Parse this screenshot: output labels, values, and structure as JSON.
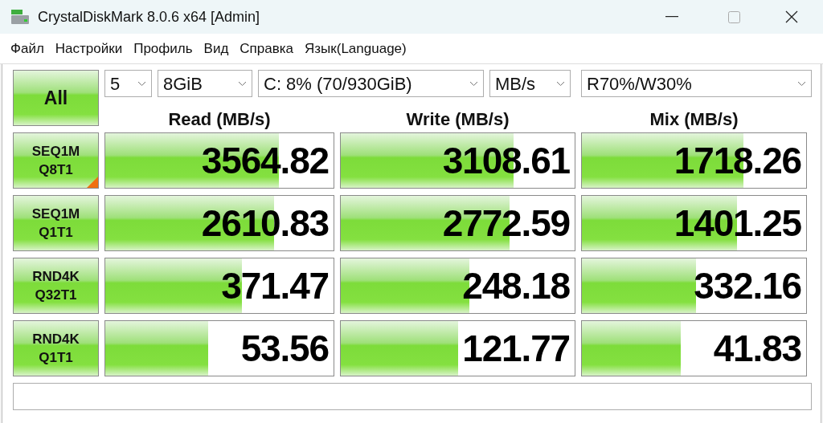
{
  "window": {
    "title": "CrystalDiskMark 8.0.6 x64 [Admin]"
  },
  "menu": [
    "Файл",
    "Настройки",
    "Профиль",
    "Вид",
    "Справка",
    "Язык(Language)"
  ],
  "all_button": "All",
  "settings": {
    "count": "5",
    "size": "8GiB",
    "drive": "C: 8% (70/930GiB)",
    "unit": "MB/s",
    "mix": "R70%/W30%"
  },
  "columns": [
    "Read (MB/s)",
    "Write (MB/s)",
    "Mix (MB/s)"
  ],
  "tests": [
    {
      "line1": "SEQ1M",
      "line2": "Q8T1",
      "flagged": true,
      "results": [
        {
          "value": "3564.82",
          "level": 0.76
        },
        {
          "value": "3108.61",
          "level": 0.74
        },
        {
          "value": "1718.26",
          "level": 0.72
        }
      ]
    },
    {
      "line1": "SEQ1M",
      "line2": "Q1T1",
      "flagged": false,
      "results": [
        {
          "value": "2610.83",
          "level": 0.74
        },
        {
          "value": "2772.59",
          "level": 0.72
        },
        {
          "value": "1401.25",
          "level": 0.69
        }
      ]
    },
    {
      "line1": "RND4K",
      "line2": "Q32T1",
      "flagged": false,
      "results": [
        {
          "value": "371.47",
          "level": 0.6
        },
        {
          "value": "248.18",
          "level": 0.55
        },
        {
          "value": "332.16",
          "level": 0.51
        }
      ]
    },
    {
      "line1": "RND4K",
      "line2": "Q1T1",
      "flagged": false,
      "results": [
        {
          "value": "53.56",
          "level": 0.45
        },
        {
          "value": "121.77",
          "level": 0.5
        },
        {
          "value": "41.83",
          "level": 0.44
        }
      ]
    }
  ]
}
